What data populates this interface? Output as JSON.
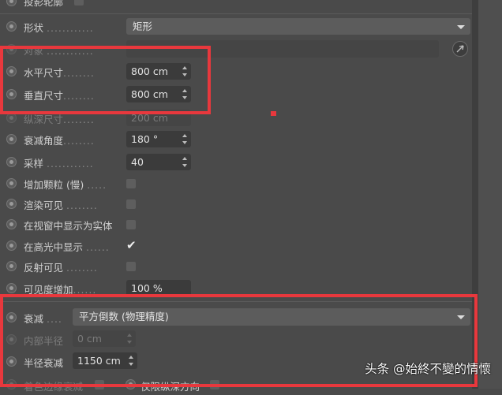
{
  "rows": {
    "top_cut": {
      "label": "投影轮廓"
    },
    "shape": {
      "label": "形状",
      "dots": "............",
      "value": "矩形"
    },
    "object": {
      "label": "对象",
      "dots": "............"
    },
    "width": {
      "label": "水平尺寸",
      "dots": "........",
      "value": "800 cm"
    },
    "height": {
      "label": "垂直尺寸",
      "dots": "........",
      "value": "800 cm"
    },
    "depth": {
      "label": "纵深尺寸",
      "dots": "........",
      "value": "200 cm"
    },
    "falloff_angle": {
      "label": "衰减角度",
      "dots": "........",
      "value": "180 °"
    },
    "samples": {
      "label": "采样",
      "dots": "............",
      "value": "40"
    },
    "add_grain": {
      "label": "增加颗粒 (慢)",
      "dots": ".....",
      "checked": false
    },
    "show_in_render": {
      "label": "渲染可见",
      "dots": "........",
      "checked": false
    },
    "show_as_solid": {
      "label": "在视窗中显示为实体",
      "checked": false
    },
    "show_in_highlight": {
      "label": "在高光中显示",
      "dots": "......",
      "checked": true
    },
    "reflection_visible": {
      "label": "反射可见",
      "dots": "........",
      "checked": false
    },
    "visibility_boost": {
      "label": "可见度增加",
      "dots": "......",
      "value": "100 %"
    },
    "falloff": {
      "label": "衰减",
      "dots": "....",
      "value": "平方倒数 (物理精度)"
    },
    "inner_radius": {
      "label": "内部半径",
      "value": "0 cm"
    },
    "radius_falloff": {
      "label": "半径衰减",
      "value": "1150 cm"
    },
    "bottom_left": {
      "label": "着色边缘衰减"
    },
    "bottom_right": {
      "label": "仅限纵深方向"
    }
  },
  "watermark": "头条 @始終不變的情懷",
  "colors": {
    "highlight_box": "#e8383d",
    "panel_bg": "#4a4a4a",
    "field_bg": "#3b3b3b"
  }
}
